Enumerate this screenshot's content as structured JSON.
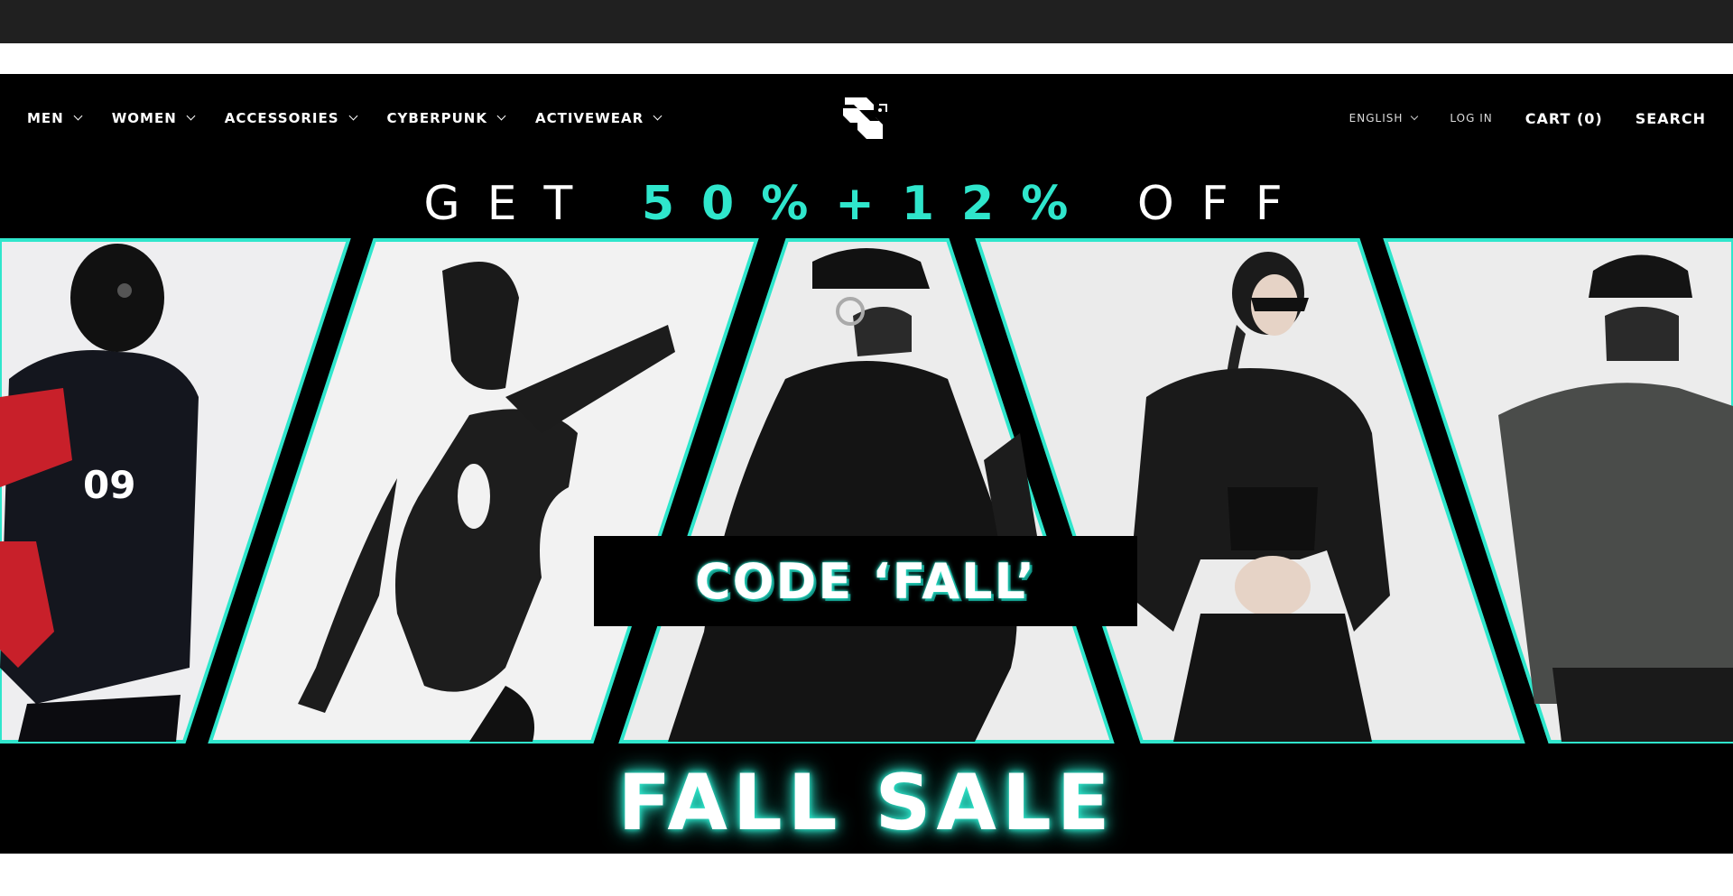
{
  "nav": {
    "left": [
      {
        "label": "MEN",
        "icon": "chevron-down-icon"
      },
      {
        "label": "WOMEN",
        "icon": "chevron-down-icon"
      },
      {
        "label": "ACCESSORIES",
        "icon": "chevron-down-icon"
      },
      {
        "label": "CYBERPUNK",
        "icon": "chevron-down-icon"
      },
      {
        "label": "ACTIVEWEAR",
        "icon": "chevron-down-icon"
      }
    ],
    "language": "ENGLISH",
    "login": "LOG IN",
    "cart": "CART (0)",
    "search": "SEARCH"
  },
  "banner": {
    "headline_prefix": "GET",
    "headline_accent": "50%+12%",
    "headline_suffix": "OFF",
    "code": "CODE ‘FALL’",
    "sale": "FALL SALE",
    "accent_color": "#2fe6cc"
  }
}
